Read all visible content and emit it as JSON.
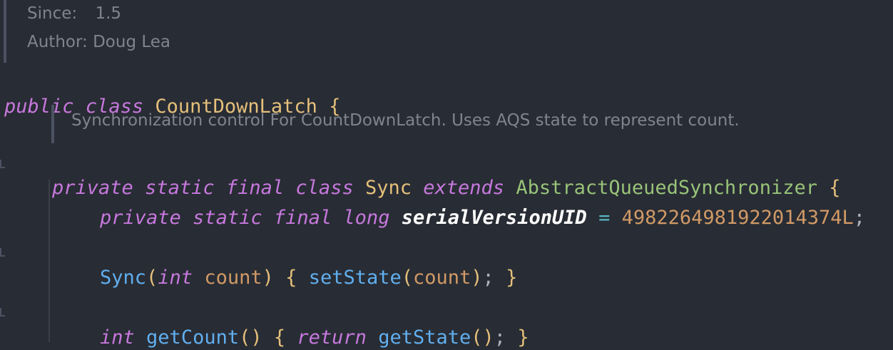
{
  "doc_header": {
    "since_label": "Since:",
    "since_value": "1.5",
    "author_label": "Author:",
    "author_value": "Doug Lea"
  },
  "line1": {
    "kw_public": "public",
    "kw_class": "class",
    "class_name": "CountDownLatch",
    "brace": "{"
  },
  "doc_sync": {
    "text": "Synchronization control For CountDownLatch. Uses AQS state to represent count."
  },
  "line2": {
    "kw_private": "private",
    "kw_static": "static",
    "kw_final": "final",
    "kw_class": "class",
    "class_name": "Sync",
    "kw_extends": "extends",
    "super_name": "AbstractQueuedSynchronizer",
    "brace": "{"
  },
  "line3": {
    "kw_private": "private",
    "kw_static": "static",
    "kw_final": "final",
    "kw_long": "long",
    "field": "serialVersionUID",
    "op": "=",
    "value": "4982264981922014374L",
    "semi": ";"
  },
  "line4": {
    "ctor": "Sync",
    "lparen": "(",
    "kw_int": "int",
    "param": "count",
    "rparen": ")",
    "lbrace": "{",
    "call": "setState",
    "call_lparen": "(",
    "arg": "count",
    "call_rparen": ")",
    "semi": ";",
    "rbrace": "}"
  },
  "line5": {
    "kw_int": "int",
    "method": "getCount",
    "parens": "()",
    "lbrace": "{",
    "kw_return": "return",
    "call": "getState",
    "call_parens": "()",
    "semi": ";",
    "rbrace": "}"
  }
}
